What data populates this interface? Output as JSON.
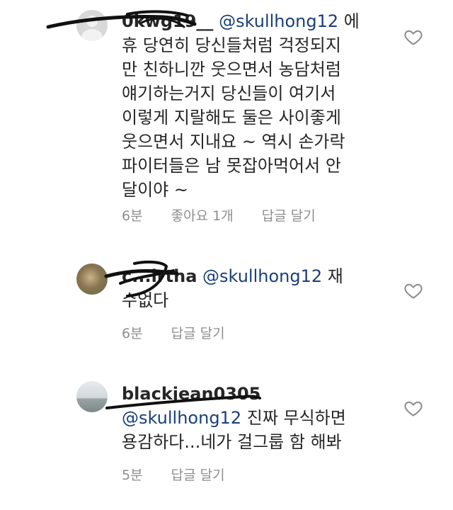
{
  "comments": [
    {
      "username": "0kwg19__",
      "mention": "@skullhong12",
      "text": "에휴 당연히 당신들처럼 걱정되지만 친하니깐 웃으면서 농담처럼 얘기하는거지 당신들이 여기서 이렇게 지랄해도 둘은 사이좋게 웃으면서 지내요 ~ 역시 손가락 파이터들은 남 못잡아먹어서 안달이야 ~",
      "lines": [
        "휴 당연히 당신들처럼 걱정되지",
        "만 친하니깐 웃으면서 농담처럼",
        "얘기하는거지 당신들이 여기서",
        "이렇게 지랄해도 둘은 사이좋게",
        "웃으면서 지내요 ~ 역시 손가락",
        "파이터들은 남 못잡아먹어서 안",
        "달이야 ~"
      ],
      "first_line_suffix": "에",
      "time": "6분",
      "likes": "좋아요 1개",
      "reply": "답글 달기",
      "avatar": "default-profile-icon"
    },
    {
      "username": "c...lrtha",
      "mention": "@skullhong12",
      "first_line_suffix": "재",
      "lines": [
        "수없다"
      ],
      "time": "6분",
      "reply": "답글 달기",
      "avatar": "cheetah-profile-photo"
    },
    {
      "username": "blackjean0305",
      "mention": "@skullhong12",
      "lines": [
        "진짜 무식하면",
        "용감하다...네가 걸그룹 함 해봐"
      ],
      "time": "5분",
      "reply": "답글 달기",
      "avatar": "landscape-profile-photo"
    }
  ],
  "icons": {
    "like": "heart-outline-icon"
  },
  "colors": {
    "text": "#262626",
    "mention": "#1a3f79",
    "meta": "#8e8e8e",
    "scribble": "#111111"
  }
}
